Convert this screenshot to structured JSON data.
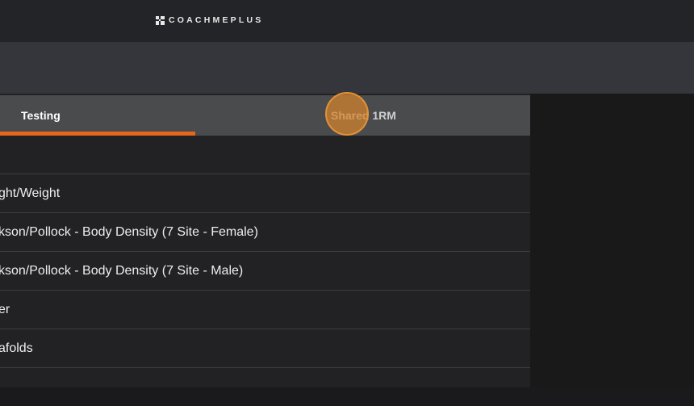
{
  "header": {
    "logo_text": "COACHMEPLUS"
  },
  "tabs": [
    {
      "label": "Testing",
      "active": true
    },
    {
      "label": "Shared 1RM",
      "active": false
    }
  ],
  "colors": {
    "accent": "#e8661a",
    "topbar": "#232427",
    "subbar": "#34363b",
    "tabbar": "#4a4b4d"
  },
  "list": {
    "items": [
      {
        "label": ""
      },
      {
        "label": "ght/Weight"
      },
      {
        "label": "kson/Pollock - Body Density (7 Site - Female)"
      },
      {
        "label": "kson/Pollock - Body Density (7 Site - Male)"
      },
      {
        "label": "er"
      },
      {
        "label": "afolds"
      },
      {
        "label": ""
      }
    ]
  }
}
